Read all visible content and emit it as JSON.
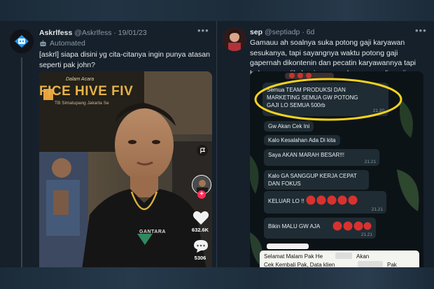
{
  "left_tweet": {
    "display_name": "Askrlfess",
    "handle": "@Askrlfess",
    "date": "19/01/23",
    "automated_label": "Automated",
    "text": "[askrl] siapa disini yg cita-citanya ingin punya atasan seperti pak john?",
    "video": {
      "banner_small": "Dalam Acara",
      "banner_main": "FICE HIVE FIV",
      "banner_sub": "TB Simatupang Jakarta Se",
      "shirt_text": "GANTARA",
      "like_count": "632.6K",
      "comment_count": "5306"
    },
    "icons": [
      "more-icon",
      "robot-icon",
      "flag-icon",
      "heart-icon",
      "comment-icon",
      "plus-icon"
    ]
  },
  "right_tweet": {
    "display_name": "sep",
    "handle": "@septiadp",
    "age": "6d",
    "text": "Gamauu ah soalnya suka potong gaji karyawan sesukanya, tapi sayangnya waktu potong gaji gapernah dikontenin dan pecatin karyawannya tapi hakmya ga dikeluarin yang seharusnya, slip gaji pun gapernah ada.",
    "chat": {
      "highlighted": {
        "text": "Semua TEAM PRODUKSI DAN MARKETING SEMUA GW POTONG GAJI LO SEMUA 500rb",
        "time": "21.20"
      },
      "messages": [
        {
          "text": "Gw Akan Cek Ini",
          "time": ""
        },
        {
          "text": "Kalo Kesalahan Ada Di kita",
          "time": ""
        },
        {
          "text": "Saya AKAN MARAH BESAR!!!",
          "time": "21.21"
        },
        {
          "text": "Kalo GA SANGGUP KERJA CEPAT DAN FOKUS",
          "time": ""
        },
        {
          "text": "KELUAR LO !!",
          "time": "21.21"
        },
        {
          "text": "Bikin MALU GW AJA",
          "time": "21.21"
        }
      ],
      "incoming": {
        "line1": "Selamat Malam Pak He",
        "line1_end": "Akan",
        "line2": "Cek Kembali Pak, Data klien",
        "line2_end": "Pak"
      }
    },
    "icons": [
      "more-icon",
      "angry-face-icon"
    ],
    "colors": {
      "highlight": "#f4d21f",
      "bubble": "#1f2c34",
      "chat_bg": "#0b141a"
    }
  }
}
